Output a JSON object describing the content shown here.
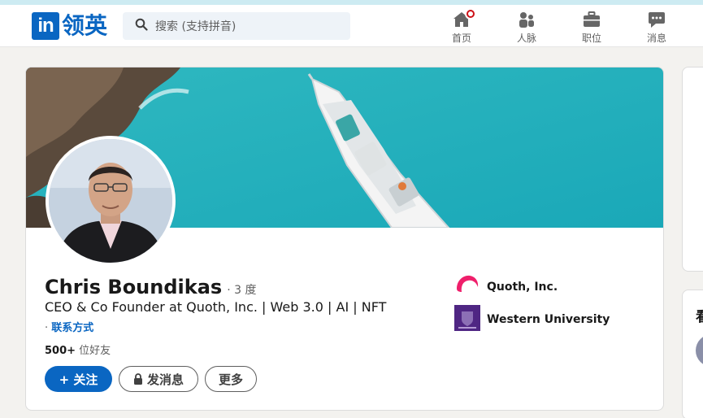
{
  "brand": {
    "logo_mark": "in",
    "logo_text": "领英",
    "color": "#0a66c2"
  },
  "search": {
    "placeholder": "搜索 (支持拼音)",
    "icon": "search-icon"
  },
  "nav": [
    {
      "label": "首页",
      "icon": "home-icon",
      "has_badge": true
    },
    {
      "label": "人脉",
      "icon": "people-icon"
    },
    {
      "label": "职位",
      "icon": "briefcase-icon"
    },
    {
      "label": "消息",
      "icon": "chat-icon"
    }
  ],
  "profile": {
    "name": "Chris Boundikas",
    "degree": "· 3 度",
    "headline": "CEO & Co Founder at Quoth, Inc. | Web 3.0 | AI | NFT",
    "contact_prefix": "·",
    "contact_link": "联系方式",
    "connections_count": "500+",
    "connections_label": "位好友",
    "buttons": {
      "follow": "+ 关注",
      "message": "发消息",
      "more": "更多"
    },
    "organizations": [
      {
        "name": "Quoth, Inc.",
        "icon": "quoth-logo-icon"
      },
      {
        "name": "Western University",
        "icon": "western-university-logo-icon"
      }
    ]
  },
  "side": {
    "title": "看"
  }
}
